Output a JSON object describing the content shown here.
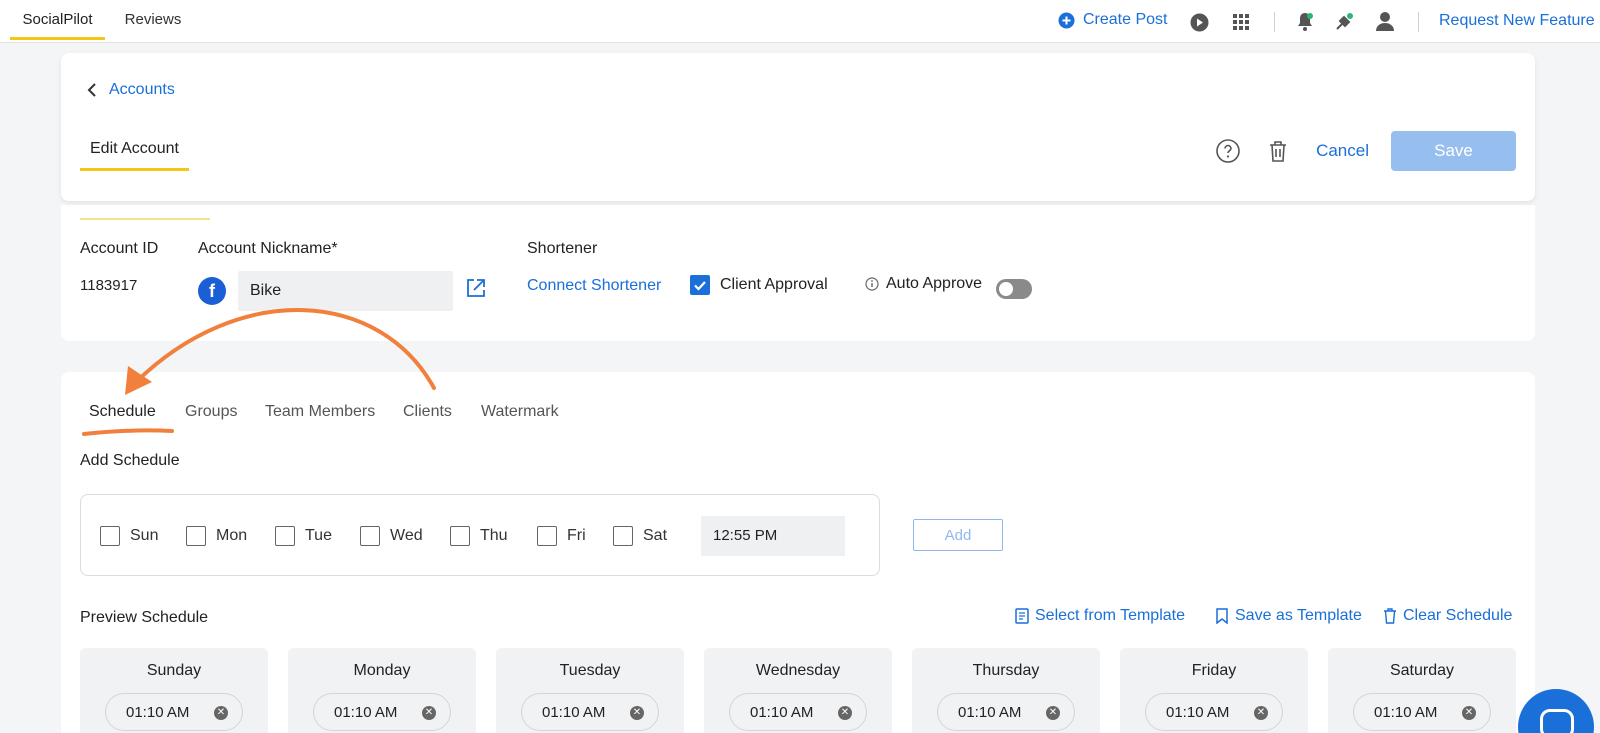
{
  "nav": {
    "tabs": [
      {
        "label": "SocialPilot",
        "active": true
      },
      {
        "label": "Reviews",
        "active": false
      }
    ],
    "create_post": "Create Post",
    "request_feature": "Request New Feature",
    "icons": [
      "plus-circle-icon",
      "play-icon",
      "grid-icon",
      "bell-icon",
      "satellite-icon",
      "user-icon"
    ]
  },
  "header": {
    "back_label": "Accounts",
    "tab_label": "Edit Account",
    "cancel_label": "Cancel",
    "save_label": "Save"
  },
  "account": {
    "id_label": "Account ID",
    "id_value": "1183917",
    "nickname_label": "Account Nickname*",
    "nickname_value": "Bike",
    "shortener_label": "Shortener",
    "connect_shortener": "Connect Shortener",
    "client_approval_label": "Client Approval",
    "client_approval_checked": true,
    "auto_approve_label": "Auto Approve",
    "auto_approve_on": false
  },
  "schedule": {
    "tabs": [
      "Schedule",
      "Groups",
      "Team Members",
      "Clients",
      "Watermark"
    ],
    "active_tab": "Schedule",
    "add_schedule_label": "Add Schedule",
    "days": [
      "Sun",
      "Mon",
      "Tue",
      "Wed",
      "Thu",
      "Fri",
      "Sat"
    ],
    "time_value": "12:55 PM",
    "add_label": "Add",
    "preview_label": "Preview Schedule",
    "select_template": "Select from Template",
    "save_template": "Save as Template",
    "clear_schedule": "Clear Schedule",
    "preview_days": [
      {
        "day": "Sunday",
        "time": "01:10 AM"
      },
      {
        "day": "Monday",
        "time": "01:10 AM"
      },
      {
        "day": "Tuesday",
        "time": "01:10 AM"
      },
      {
        "day": "Wednesday",
        "time": "01:10 AM"
      },
      {
        "day": "Thursday",
        "time": "01:10 AM"
      },
      {
        "day": "Friday",
        "time": "01:10 AM"
      },
      {
        "day": "Saturday",
        "time": "01:10 AM"
      }
    ]
  },
  "colors": {
    "accent": "#1a6fd9",
    "tab_underline": "#f5c518",
    "annotation": "#f0803c",
    "save_disabled": "#96bff0"
  }
}
